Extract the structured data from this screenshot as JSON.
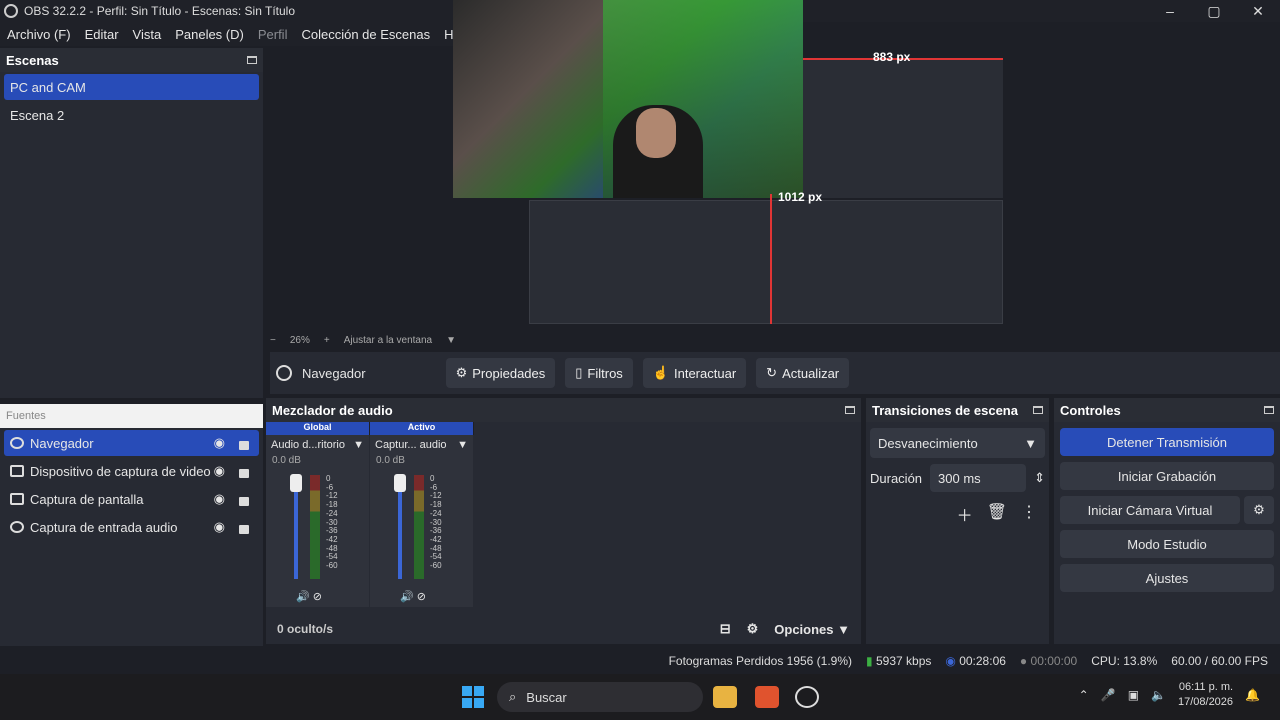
{
  "window": {
    "title": "OBS 32.2.2 - Perfil: Sin Título - Escenas: Sin Título",
    "controls": [
      "–",
      "▢",
      "✕"
    ]
  },
  "menu": [
    "Archivo (F)",
    "Editar",
    "Vista",
    "Paneles (D)",
    "Perfil",
    "Colección de Escenas",
    "Herra"
  ],
  "scenes": {
    "title": "Escenas",
    "items": [
      "PC and CAM",
      "Escena 2"
    ]
  },
  "preview": {
    "label_top": "883 px",
    "label_red": "1012 px",
    "zoom": "26%",
    "fit_label": "Ajustar a la ventana"
  },
  "source_bar": {
    "selected_name": "Navegador",
    "buttons": [
      "Propiedades",
      "Filtros",
      "Interactuar",
      "Actualizar"
    ]
  },
  "sources": {
    "title": "Fuentes",
    "items": [
      "Navegador",
      "Dispositivo de captura de video",
      "Captura de pantalla",
      "Captura de entrada audio"
    ]
  },
  "mixer": {
    "title": "Mezclador de audio",
    "tab_global": "Global",
    "tab_active": "Activo",
    "channels": [
      {
        "name": "Audio d...ritorio",
        "db": "0.0 dB"
      },
      {
        "name": "Captur... audio",
        "db": "0.0 dB"
      }
    ],
    "ticks": [
      "0",
      "-6",
      "-12",
      "-18",
      "-24",
      "-30",
      "-36",
      "-42",
      "-48",
      "-54",
      "-60"
    ],
    "hidden_label": "0 oculto/s",
    "options_label": "Opciones"
  },
  "transitions": {
    "title": "Transiciones de escena",
    "selected": "Desvanecimiento",
    "duration_label": "Duración",
    "duration_value": "300 ms"
  },
  "controls": {
    "title": "Controles",
    "stop_stream": "Detener Transmisión",
    "start_record": "Iniciar Grabación",
    "start_vcam": "Iniciar Cámara Virtual",
    "studio_mode": "Modo Estudio",
    "settings": "Ajustes"
  },
  "status": {
    "dropped": "Fotogramas Perdidos 1956 (1.9%)",
    "bitrate": "5937 kbps",
    "stream_time": "00:28:06",
    "rec_time": "00:00:00",
    "cpu": "CPU: 13.8%",
    "fps": "60.00 / 60.00 FPS"
  },
  "taskbar": {
    "search_placeholder": "Buscar",
    "time": "06:11 p. m.",
    "date": "17/08/2026"
  },
  "colors": {
    "accent": "#284cb8",
    "panel": "#272a33",
    "background": "#1d1f26"
  }
}
